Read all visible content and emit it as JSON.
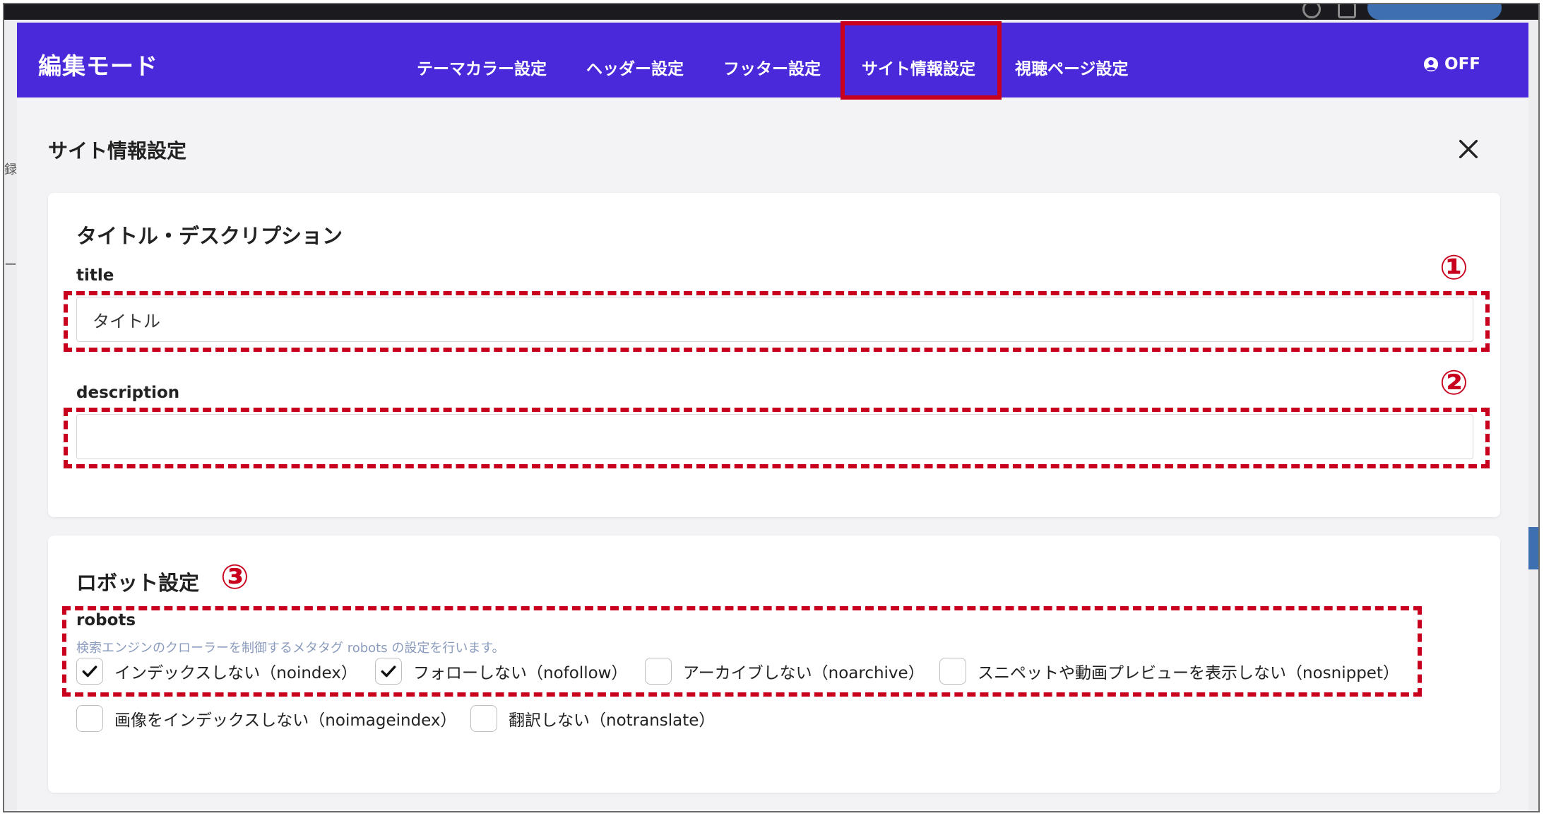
{
  "navbar": {
    "app_title": "編集モード",
    "tabs": [
      {
        "label": "テーマカラー設定"
      },
      {
        "label": "ヘッダー設定"
      },
      {
        "label": "フッター設定"
      },
      {
        "label": "サイト情報設定",
        "active": true
      },
      {
        "label": "視聴ページ設定"
      }
    ],
    "toggle_label": "OFF",
    "toggle_icon": "user-circle-icon",
    "bg_color": "#4a29db"
  },
  "page": {
    "section_title": "サイト情報設定",
    "close_icon": "close-icon"
  },
  "title_description": {
    "heading": "タイトル・デスクリプション",
    "title_label": "title",
    "title_value": "タイトル",
    "description_label": "description",
    "description_value": ""
  },
  "robots": {
    "heading": "ロボット設定",
    "label": "robots",
    "help": "検索エンジンのクローラーを制御するメタタグ robots の設定を行います。",
    "options": [
      {
        "label": "インデックスしない（noindex）",
        "checked": true
      },
      {
        "label": "フォローしない（nofollow）",
        "checked": true
      },
      {
        "label": "アーカイブしない（noarchive）",
        "checked": false
      },
      {
        "label": "スニペットや動画プレビューを表示しない（nosnippet）",
        "checked": false
      },
      {
        "label": "画像をインデックスしない（noimageindex）",
        "checked": false
      },
      {
        "label": "翻訳しない（notranslate）",
        "checked": false
      }
    ]
  },
  "annotations": {
    "n1": "①",
    "n2": "②",
    "n3": "③",
    "color": "#c8001e"
  }
}
